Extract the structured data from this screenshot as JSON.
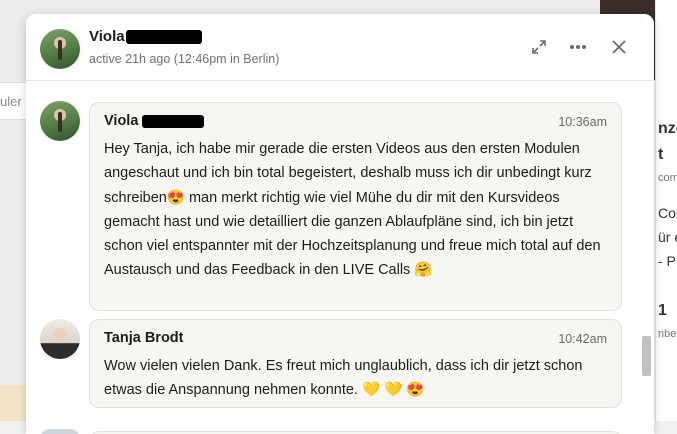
{
  "background": {
    "left_field_text": "uler",
    "right_fragments": [
      "nze",
      "t",
      "com",
      "Cor",
      "ür e",
      "- P",
      "1",
      "nber"
    ]
  },
  "header": {
    "name": "Viola",
    "status": "active 21h ago (12:46pm in Berlin)",
    "actions": [
      "expand-icon",
      "more-icon",
      "close-icon"
    ]
  },
  "messages": [
    {
      "sender": "Viola",
      "time": "10:36am",
      "text": "Hey Tanja, ich habe mir gerade die ersten Videos aus den ersten Modulen angeschaut und ich bin total begeistert, deshalb muss ich dir unbedingt kurz schreiben😍 man merkt richtig wie viel Mühe du dir mit den Kursvideos gemacht hast und wie detailliert die ganzen Ablaufpläne sind, ich bin jetzt schon viel entspannter mit der Hochzeitsplanung und freue mich total auf den Austausch und das Feedback in den LIVE Calls 🤗"
    },
    {
      "sender": "Tanja Brodt",
      "time": "10:42am",
      "text": "Wow vielen vielen Dank. Es freut mich unglaublich, dass ich dir jetzt schon etwas die Anspannung nehmen konnte. 💛 💛 😍"
    }
  ],
  "colors": {
    "bubble_bg": "#f7f6f3",
    "bubble_border": "#e1e0dc",
    "text": "#1c1c1c",
    "muted": "#707070"
  }
}
